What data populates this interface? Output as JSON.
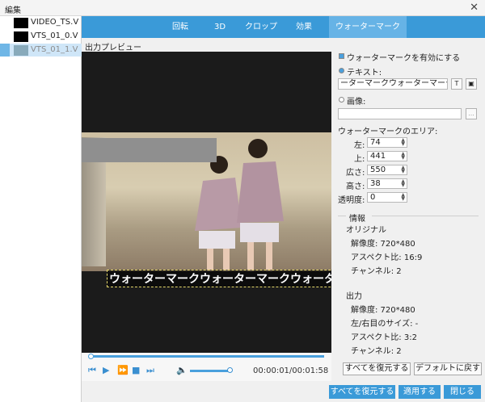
{
  "window": {
    "title": "編集",
    "close": "✕"
  },
  "files": [
    {
      "name": "VIDEO_TS.V"
    },
    {
      "name": "VTS_01_0.V"
    },
    {
      "name": "VTS_01_1.V"
    }
  ],
  "tabs": [
    "回転",
    "3D",
    "クロップ",
    "効果",
    "ウォーターマーク"
  ],
  "active_tab": "ウォーターマーク",
  "preview": {
    "label": "出力プレビュー",
    "watermark_text": "ウォーターマークウォーターマークウォーターマーク",
    "time": "00:00:01/00:01:58"
  },
  "watermark": {
    "enable_label": "ウォーターマークを有効にする",
    "text_label": "テキスト:",
    "text_value": "ーターマークウォーターマーク",
    "text_btn": "T",
    "color_btn": "▣",
    "image_label": "画像:",
    "image_value": "",
    "browse": "...",
    "area_label": "ウォーターマークのエリア:",
    "fields": [
      {
        "label": "左:",
        "value": "74"
      },
      {
        "label": "上:",
        "value": "441"
      },
      {
        "label": "広さ:",
        "value": "550"
      },
      {
        "label": "高さ:",
        "value": "38"
      },
      {
        "label": "透明度:",
        "value": "0"
      }
    ]
  },
  "info": {
    "title": "情報",
    "original_title": "オリジナル",
    "original": [
      "解像度: 720*480",
      "アスペクト比: 16:9",
      "チャンネル: 2"
    ],
    "output_title": "出力",
    "output": [
      "解像度: 720*480",
      "左/右目のサイズ: -",
      "アスペクト比: 3:2",
      "チャンネル: 2"
    ]
  },
  "buttons": {
    "restore_all_panel": "すべてを復元する",
    "default": "デフォルトに戻す",
    "restore_all": "すべてを復元する",
    "apply": "適用する",
    "close": "閉じる"
  },
  "colors": {
    "accent": "#3a9ad8"
  }
}
